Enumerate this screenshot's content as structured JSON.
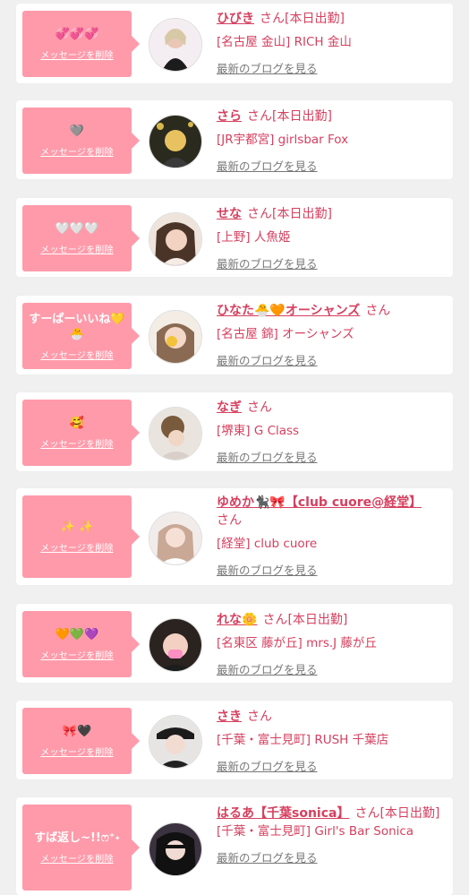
{
  "delete_label": "メッセージを削除",
  "blog_label": "最新のブログを見る",
  "honorific": "さん",
  "colors": {
    "accent": "#d6405f",
    "bubble": "#ff9aaa",
    "background": "#f0f0f0"
  },
  "cards": [
    {
      "message": "💞💞💞",
      "name": "ひびき",
      "status": "[本日出勤]",
      "shop": "[名古屋 金山] RICH 金山"
    },
    {
      "message": "🩶",
      "name": "さら",
      "status": "[本日出勤]",
      "shop": "[JR宇都宮] girlsbar Fox"
    },
    {
      "message": "🤍🤍🤍",
      "name": "せな",
      "status": "[本日出勤]",
      "shop": "[上野] 人魚姫"
    },
    {
      "message": "すーぱーいいね💛🐣",
      "name": "ひなた🐣🧡オーシャンズ",
      "status": "",
      "shop": "[名古屋 錦] オーシャンズ"
    },
    {
      "message": "🥰",
      "name": "なぎ",
      "status": "",
      "shop": "[堺東] G Class"
    },
    {
      "message": "✨ ✨",
      "name": "ゆめか🐈‍⬛🎀【club cuore@経堂】",
      "status": "",
      "shop": "[経堂] club cuore"
    },
    {
      "message": "🧡💚💜",
      "name": "れな🌼",
      "status": "[本日出勤]",
      "shop": "[名東区 藤が丘] mrs.J 藤が丘"
    },
    {
      "message": "🎀🖤",
      "name": "さき",
      "status": "",
      "shop": "[千葉・富士見町] RUSH 千葉店"
    },
    {
      "message": "すば返し~!!ෆ⁺˖",
      "name": "はるあ【千葉sonica】",
      "status": "[本日出勤]",
      "shop": "[千葉・富士見町] Girl's Bar Sonica"
    }
  ]
}
